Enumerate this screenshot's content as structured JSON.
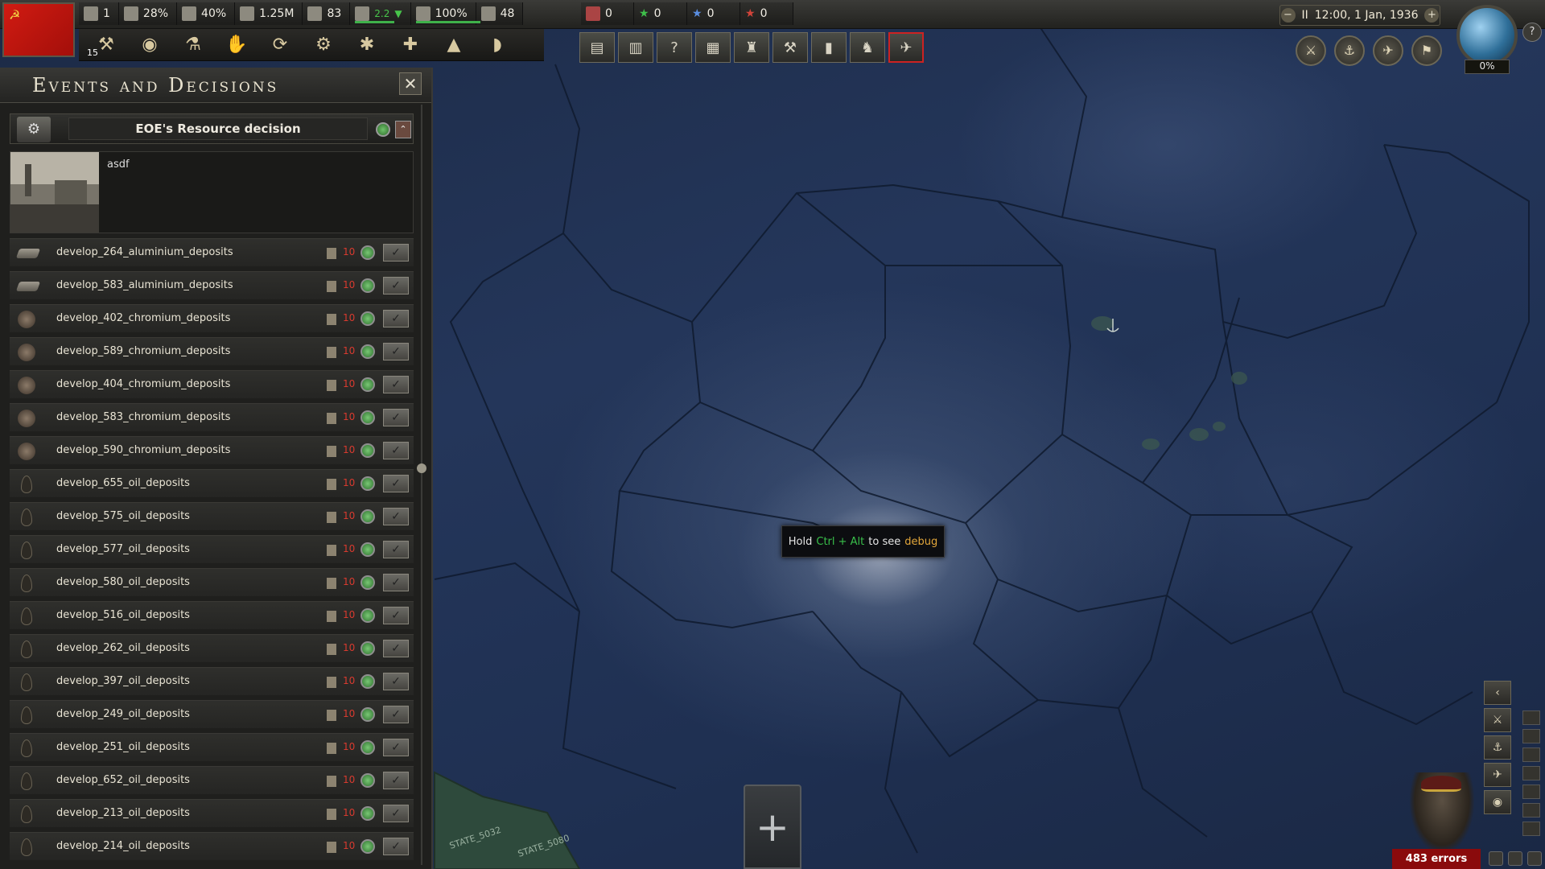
{
  "topbar": {
    "resources": [
      {
        "icon": "political-power-icon",
        "value": "1"
      },
      {
        "icon": "stability-icon",
        "value": "28%"
      },
      {
        "icon": "war-support-icon",
        "value": "40%"
      },
      {
        "icon": "manpower-icon",
        "value": "1.25M"
      },
      {
        "icon": "factories-icon",
        "value": "83"
      },
      {
        "icon": "fuel-icon",
        "value": "2.2",
        "trend": "▼",
        "level": 0.7
      },
      {
        "icon": "supply-icon",
        "value": "100%",
        "level": 1.0
      },
      {
        "icon": "convoys-icon",
        "value": "48"
      }
    ],
    "indicators": [
      {
        "icon": "spy-icon",
        "value": "0"
      },
      {
        "icon": "green-star-icon",
        "value": "0"
      },
      {
        "icon": "blue-star-icon",
        "value": "0"
      },
      {
        "icon": "red-star-icon",
        "value": "0"
      }
    ],
    "clock": {
      "pause": "II",
      "time": "12:00, 1 Jan, 1936",
      "minus": "−",
      "plus": "+"
    },
    "globe_percent": "0%",
    "help": "?"
  },
  "toolbar": {
    "research_badge": "15",
    "buttons": [
      "government-icon",
      "intelligence-icon",
      "research-icon",
      "diplomacy-icon",
      "trade-icon",
      "construction-icon",
      "production-icon",
      "recruit-icon",
      "logistics-icon",
      "decisions-icon"
    ]
  },
  "alerts": [
    "alert-political",
    "alert-research",
    "alert-unknown",
    "alert-production",
    "alert-army",
    "alert-construction",
    "alert-trade",
    "alert-division",
    "alert-map"
  ],
  "panel": {
    "title": "Events and Decisions",
    "close": "✕",
    "category": {
      "title": "EOE's Resource decision",
      "collapse": "⌃",
      "description": "asdf"
    },
    "decisions": [
      {
        "name": "develop_264_aluminium_deposits",
        "type": "alu",
        "cost": "10"
      },
      {
        "name": "develop_583_aluminium_deposits",
        "type": "alu",
        "cost": "10"
      },
      {
        "name": "develop_402_chromium_deposits",
        "type": "chrom",
        "cost": "10"
      },
      {
        "name": "develop_589_chromium_deposits",
        "type": "chrom",
        "cost": "10"
      },
      {
        "name": "develop_404_chromium_deposits",
        "type": "chrom",
        "cost": "10"
      },
      {
        "name": "develop_583_chromium_deposits",
        "type": "chrom",
        "cost": "10"
      },
      {
        "name": "develop_590_chromium_deposits",
        "type": "chrom",
        "cost": "10"
      },
      {
        "name": "develop_655_oil_deposits",
        "type": "oil",
        "cost": "10"
      },
      {
        "name": "develop_575_oil_deposits",
        "type": "oil",
        "cost": "10"
      },
      {
        "name": "develop_577_oil_deposits",
        "type": "oil",
        "cost": "10"
      },
      {
        "name": "develop_580_oil_deposits",
        "type": "oil",
        "cost": "10"
      },
      {
        "name": "develop_516_oil_deposits",
        "type": "oil",
        "cost": "10"
      },
      {
        "name": "develop_262_oil_deposits",
        "type": "oil",
        "cost": "10"
      },
      {
        "name": "develop_397_oil_deposits",
        "type": "oil",
        "cost": "10"
      },
      {
        "name": "develop_249_oil_deposits",
        "type": "oil",
        "cost": "10"
      },
      {
        "name": "develop_251_oil_deposits",
        "type": "oil",
        "cost": "10"
      },
      {
        "name": "develop_652_oil_deposits",
        "type": "oil",
        "cost": "10"
      },
      {
        "name": "develop_213_oil_deposits",
        "type": "oil",
        "cost": "10"
      },
      {
        "name": "develop_214_oil_deposits",
        "type": "oil",
        "cost": "10"
      }
    ]
  },
  "map": {
    "tooltip": {
      "hold": "Hold",
      "keys": "Ctrl + Alt",
      "to_see": "to see",
      "debug": "debug"
    },
    "land_labels": [
      "STATE_5032",
      "STATE_5080"
    ],
    "add_button": "+"
  },
  "bottom_right": {
    "errors": "483 errors"
  }
}
